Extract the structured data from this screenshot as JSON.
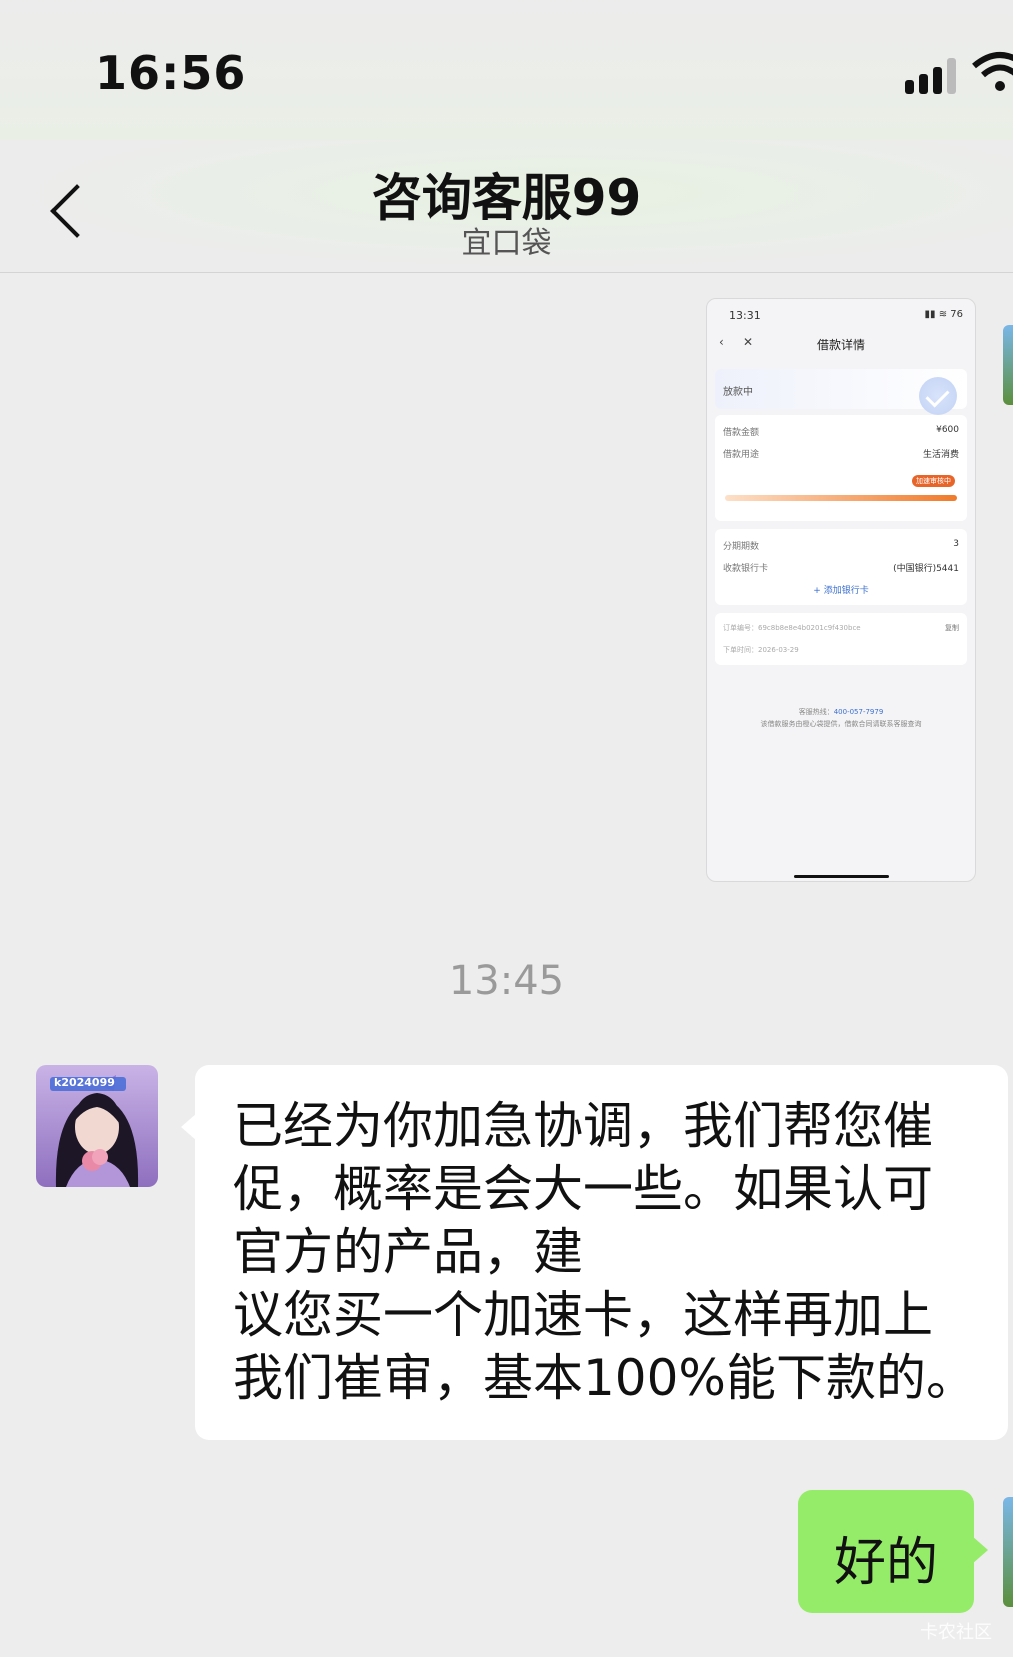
{
  "status_bar": {
    "time": "16:56"
  },
  "chat_header": {
    "back_icon": "chevron-left-icon",
    "title": "咨询客服99",
    "subtitle": "宜口袋"
  },
  "image_message": {
    "status_time": "13:31",
    "battery": "76",
    "page_title": "借款详情",
    "status_label": "放款中",
    "amount_label": "借款金额",
    "amount_value": "¥600",
    "purpose_label": "借款用途",
    "purpose_value": "生活消费",
    "speed_tag": "加速审核中",
    "installments_label": "分期期数",
    "installments_value": "3",
    "bank_label": "收款银行卡",
    "bank_value": "(中国银行)5441",
    "add_bank": "+ 添加银行卡",
    "order_label": "订单编号：",
    "order_value": "69c8b8e8e4b0201c9f430bce",
    "copy_label": "复制",
    "order_time_label": "下单时间：",
    "order_time_value": "2026-03-29",
    "hotline_label": "客服热线：",
    "hotline_value": "400-057-7979",
    "footer_note": "该借款服务由橙心袋提供，借款合同请联系客服查询"
  },
  "timestamp": "13:45",
  "incoming_message": {
    "avatar_badge": "k2024099",
    "text": "已经为你加急协调，我们帮您催\n促，概率是会大一些。如果认可\n官方的产品，建\n议您买一个加速卡，这样再加上\n我们崔审，基本100%能下款的。"
  },
  "outgoing_message": {
    "text": "好的"
  },
  "watermark": "卡农社区",
  "colors": {
    "outgoing_bubble": "#95ec69",
    "incoming_bubble": "#ffffff",
    "background": "#ededed"
  }
}
